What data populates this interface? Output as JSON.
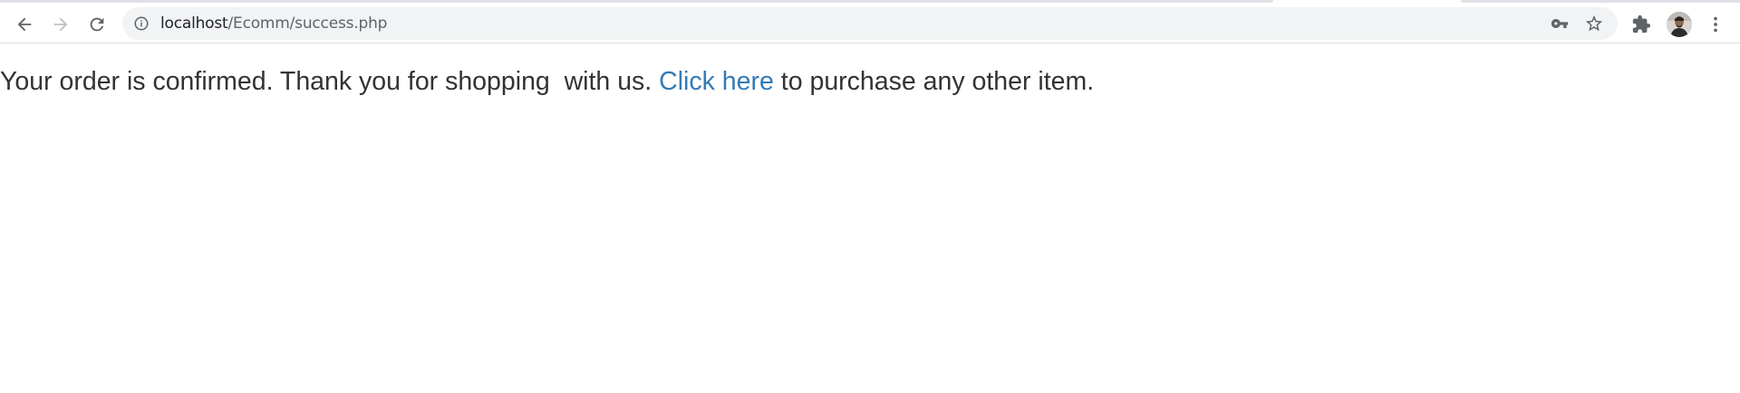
{
  "browser": {
    "url_host": "localhost",
    "url_path": "/Ecomm/success.php",
    "icons": {
      "back": "arrow-left-icon",
      "forward": "arrow-right-icon",
      "reload": "reload-icon",
      "site_info": "info-icon",
      "password": "key-icon",
      "bookmark": "star-icon",
      "extensions": "puzzle-icon",
      "profile": "avatar",
      "menu": "kebab-menu-icon"
    }
  },
  "page": {
    "message_before": "Your order is confirmed. Thank you for shopping  with us. ",
    "link_text": "Click here",
    "message_after": " to purchase any other item.",
    "link_color": "#337ab7",
    "text_color": "#333333"
  }
}
